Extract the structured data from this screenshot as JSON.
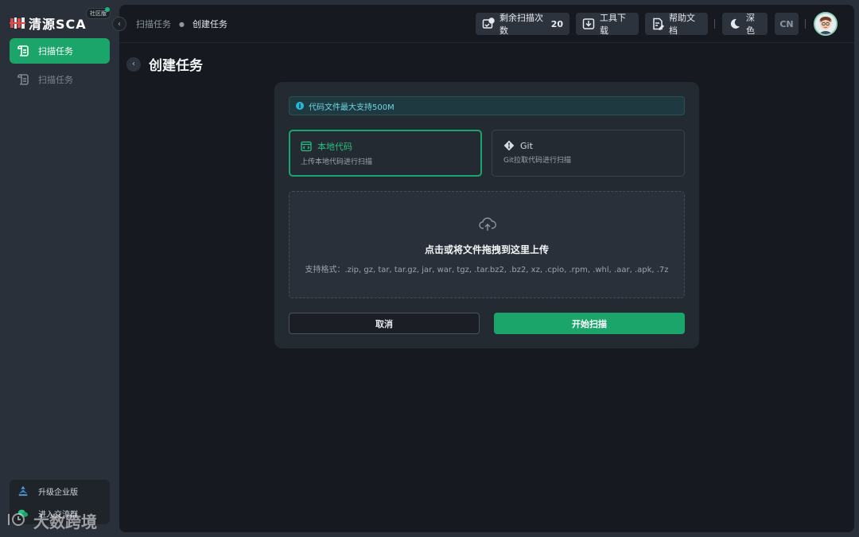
{
  "sidebar": {
    "logo_text": "清源SCA",
    "edition_badge": "社区版",
    "items": [
      {
        "label": "扫描任务",
        "active": true
      },
      {
        "label": "扫描任务",
        "active": false
      }
    ],
    "upgrade_label": "升级企业版",
    "second_label": "进入交流群"
  },
  "watermark": "大数跨境",
  "topbar": {
    "breadcrumb": [
      "扫描任务",
      "创建任务"
    ],
    "remaining_label": "剩余扫描次数",
    "remaining_count": "20",
    "tool_download": "工具下载",
    "help_docs": "帮助文档",
    "theme": "深色",
    "lang": "CN"
  },
  "page": {
    "title": "创建任务"
  },
  "card": {
    "notice": "代码文件最大支持500M",
    "options": [
      {
        "title": "本地代码",
        "desc": "上传本地代码进行扫描",
        "selected": true
      },
      {
        "title": "Git",
        "desc": "Git拉取代码进行扫描",
        "selected": false
      }
    ],
    "dropzone_title": "点击或将文件拖拽到这里上传",
    "dropzone_formats": "支持格式：.zip, gz, tar, tar.gz, jar, war, tgz, .tar.bz2, .bz2, xz, .cpio, .rpm, .whl, .aar, .apk, .7z",
    "cancel_label": "取消",
    "start_label": "开始扫描"
  },
  "colors": {
    "accent": "#1ba56b",
    "sidebar_bg": "#2a3039",
    "main_bg": "#161a20",
    "card_bg": "#242a32",
    "notice_text": "#6fd3e6"
  }
}
